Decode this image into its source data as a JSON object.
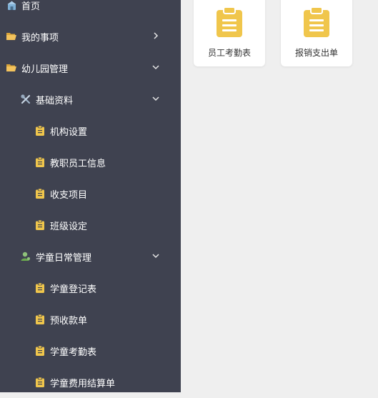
{
  "sidebar": {
    "items": [
      {
        "label": "首页",
        "icon": "home-icon"
      },
      {
        "label": "我的事项",
        "icon": "folder-open-icon",
        "chevron": "chevron-right-icon"
      },
      {
        "label": "幼儿园管理",
        "icon": "folder-open-icon",
        "chevron": "chevron-down-icon"
      },
      {
        "label": "基础资料",
        "icon": "tools-icon",
        "chevron": "chevron-down-icon"
      },
      {
        "label": "机构设置",
        "icon": "clipboard-icon"
      },
      {
        "label": "教职员工信息",
        "icon": "clipboard-icon"
      },
      {
        "label": "收支项目",
        "icon": "clipboard-icon"
      },
      {
        "label": "班级设定",
        "icon": "clipboard-icon"
      },
      {
        "label": "学童日常管理",
        "icon": "user-icon",
        "chevron": "chevron-down-icon"
      },
      {
        "label": "学童登记表",
        "icon": "clipboard-icon"
      },
      {
        "label": "预收款单",
        "icon": "clipboard-icon"
      },
      {
        "label": "学童考勤表",
        "icon": "clipboard-icon"
      },
      {
        "label": "学童费用结算单",
        "icon": "clipboard-icon"
      }
    ]
  },
  "main": {
    "cards": [
      {
        "label": "员工考勤表",
        "icon": "clipboard-icon"
      },
      {
        "label": "报销支出单",
        "icon": "clipboard-icon"
      }
    ]
  },
  "colors": {
    "sidebar_bg": "#3f4250",
    "clipboard": "#f0c64c",
    "folder": "#f3c35d",
    "page_bg": "#efefef"
  }
}
